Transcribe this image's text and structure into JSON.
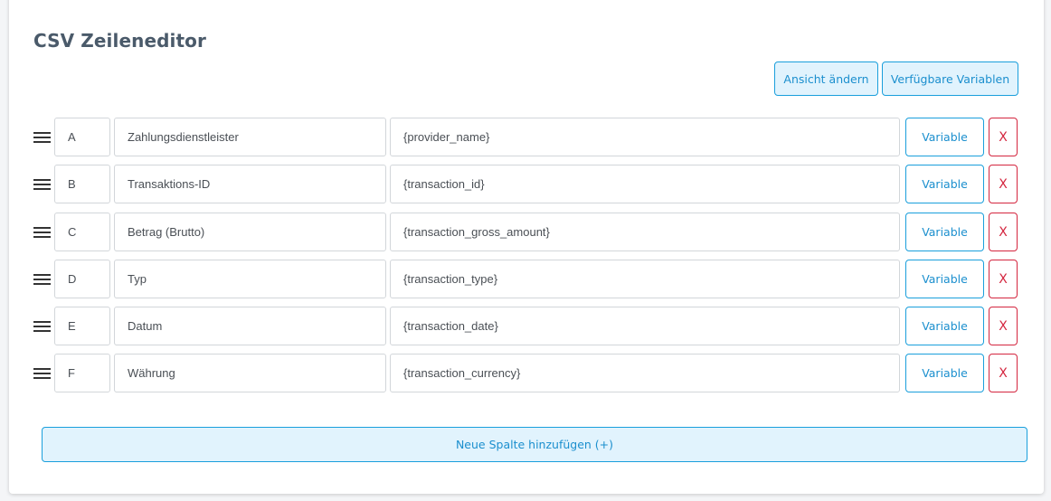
{
  "editor": {
    "title": "CSV Zeileneditor",
    "change_view_label": "Ansicht ändern",
    "available_variables_label": "Verfügbare Variablen",
    "add_column_label": "Neue Spalte hinzufügen (+)"
  },
  "rows": [
    {
      "column": "A",
      "label": "Zahlungsdienstleister",
      "variable": "{provider_name}",
      "variable_button": "Variable",
      "delete_button": "X"
    },
    {
      "column": "B",
      "label": "Transaktions-ID",
      "variable": "{transaction_id}",
      "variable_button": "Variable",
      "delete_button": "X"
    },
    {
      "column": "C",
      "label": "Betrag (Brutto)",
      "variable": "{transaction_gross_amount}",
      "variable_button": "Variable",
      "delete_button": "X"
    },
    {
      "column": "D",
      "label": "Typ",
      "variable": "{transaction_type}",
      "variable_button": "Variable",
      "delete_button": "X"
    },
    {
      "column": "E",
      "label": "Datum",
      "variable": "{transaction_date}",
      "variable_button": "Variable",
      "delete_button": "X"
    },
    {
      "column": "F",
      "label": "Währung",
      "variable": "{transaction_currency}",
      "variable_button": "Variable",
      "delete_button": "X"
    }
  ],
  "icons": {
    "drag_handle": "drag-handle-icon"
  },
  "colors": {
    "accent": "#1a9fdc",
    "accent_background": "#e1f3fd",
    "danger": "#d4263f",
    "title": "#4a5a6a"
  }
}
